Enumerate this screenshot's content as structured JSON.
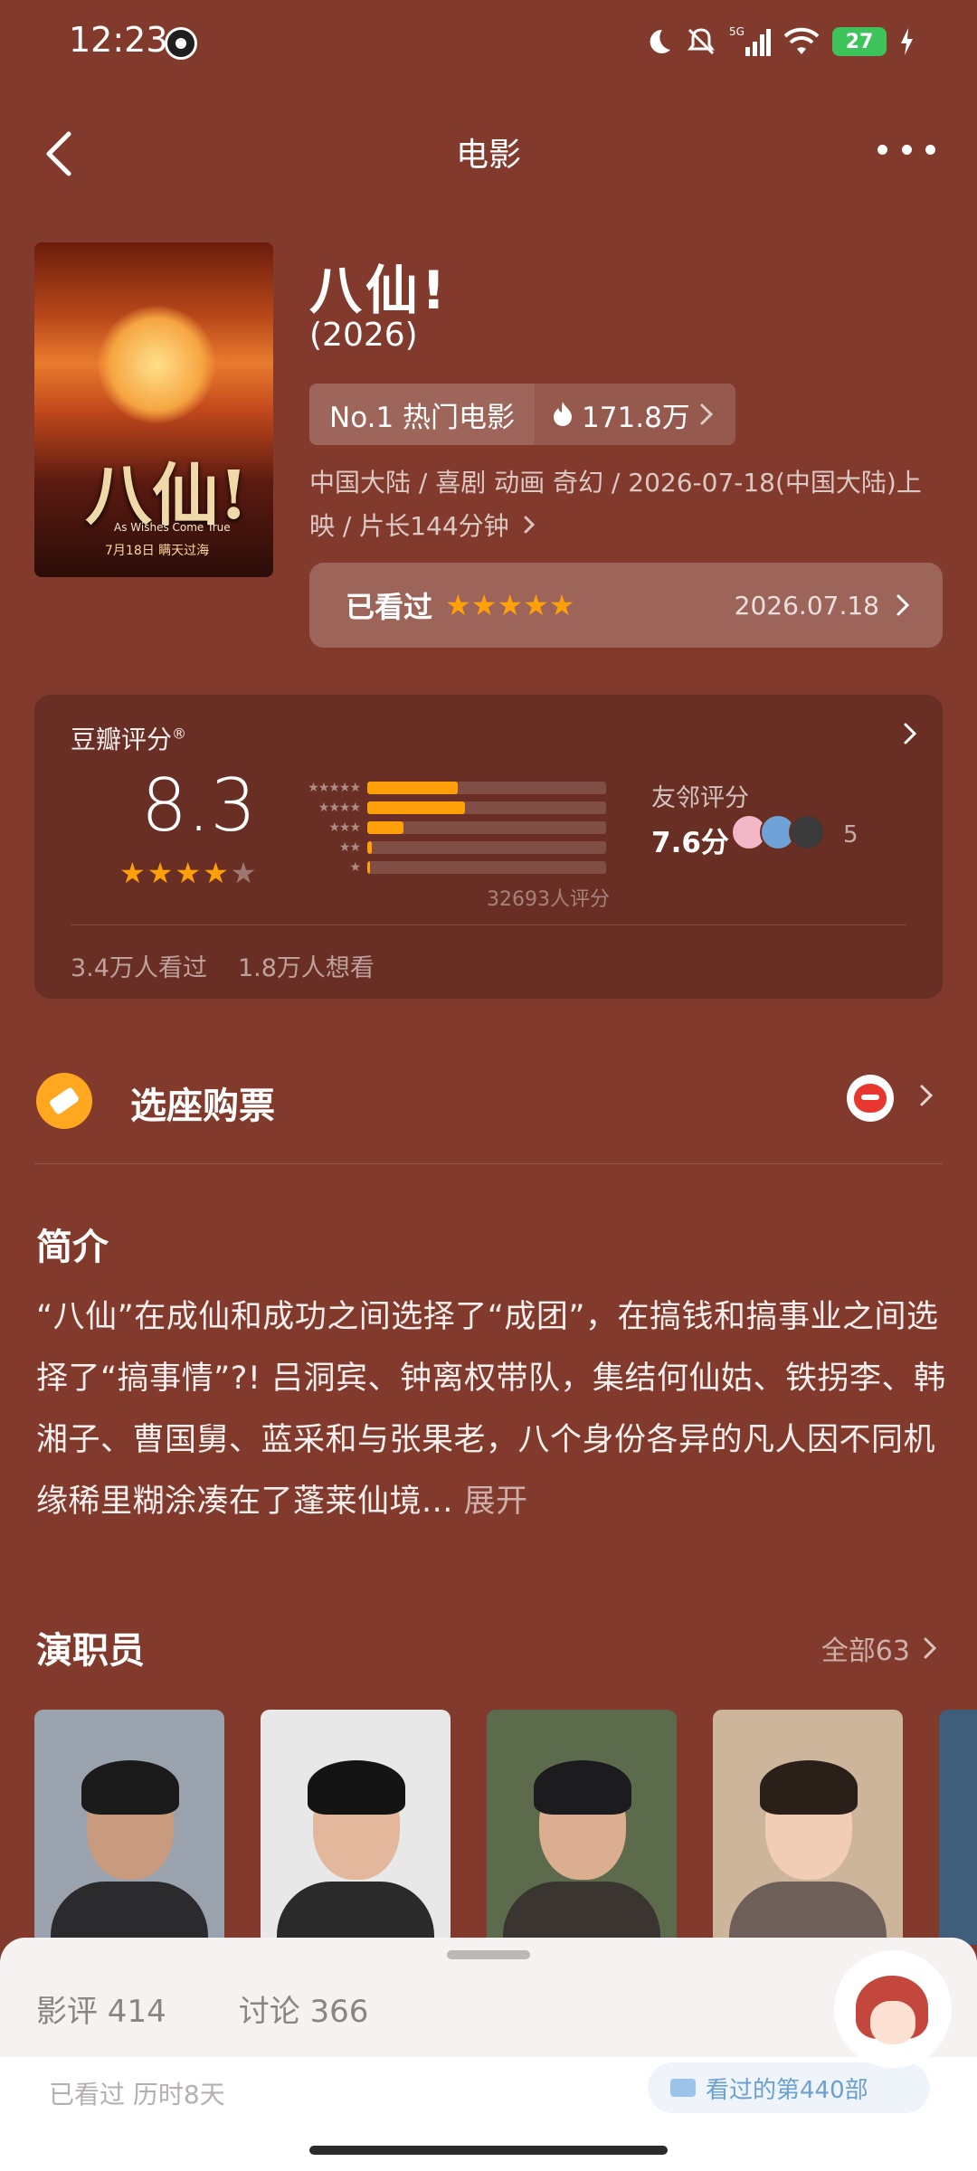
{
  "status_bar": {
    "time": "12:23",
    "network": "5G",
    "battery": "27",
    "icons": [
      "qq-icon",
      "moon-icon",
      "bell-off-icon",
      "signal-icon",
      "wifi-icon",
      "battery-icon",
      "charging-icon"
    ]
  },
  "nav": {
    "title": "电影",
    "icons": [
      "back-arrow-icon",
      "more-icon"
    ]
  },
  "poster": {
    "title_text": "八仙!",
    "subtitle_text": "As Wishes Come True",
    "date_text": "7月18日 瞒天过海"
  },
  "movie": {
    "title": "八仙!",
    "year": "(2026)",
    "rank_label": "No.1 热门电影",
    "heat_value": "171.8万",
    "meta": "中国大陆 / 喜剧 动画 奇幻 / 2026-07-18(中国大陆)上映 / 片长144分钟",
    "watched_label": "已看过",
    "watched_stars": "★★★★★",
    "watched_date": "2026.07.18"
  },
  "rating": {
    "label": "豆瓣评分",
    "label_mark": "®",
    "score": "8.3",
    "stars_full": "★★★★",
    "stars_empty": "★",
    "distribution": [
      {
        "stars": "★★★★★",
        "fraction": 0.38
      },
      {
        "stars": "★★★★",
        "fraction": 0.41
      },
      {
        "stars": "★★★",
        "fraction": 0.15
      },
      {
        "stars": "★★",
        "fraction": 0.02
      },
      {
        "stars": "★",
        "fraction": 0.01
      }
    ],
    "count": "32693人评分",
    "friend_label": "友邻评分",
    "friend_score": "7.6分",
    "friend_count": "5",
    "watched": "3.4万人看过",
    "want": "1.8万人想看"
  },
  "tickets": {
    "label": "选座购票"
  },
  "synopsis": {
    "title": "简介",
    "text": "“八仙”在成仙和成功之间选择了“成团”，在搞钱和搞事业之间选择了“搞事情”?! 吕洞宾、钟离权带队，集结何仙姑、铁拐李、韩湘子、曹国舅、蓝采和与张果老，八个身份各异的凡人因不同机缘稀里糊涂凑在了蓬莱仙境...",
    "expand": "展开"
  },
  "cast": {
    "title": "演职员",
    "all_label": "全部63"
  },
  "sheet": {
    "tabs": [
      "影评 414",
      "讨论 366"
    ],
    "row_text": "已看过  历时8天",
    "pill_text": "看过的第440部"
  },
  "colors": {
    "background": "#823A2C",
    "accent_star": "#FF9F0A",
    "ticket_icon": "#FFA81F"
  }
}
